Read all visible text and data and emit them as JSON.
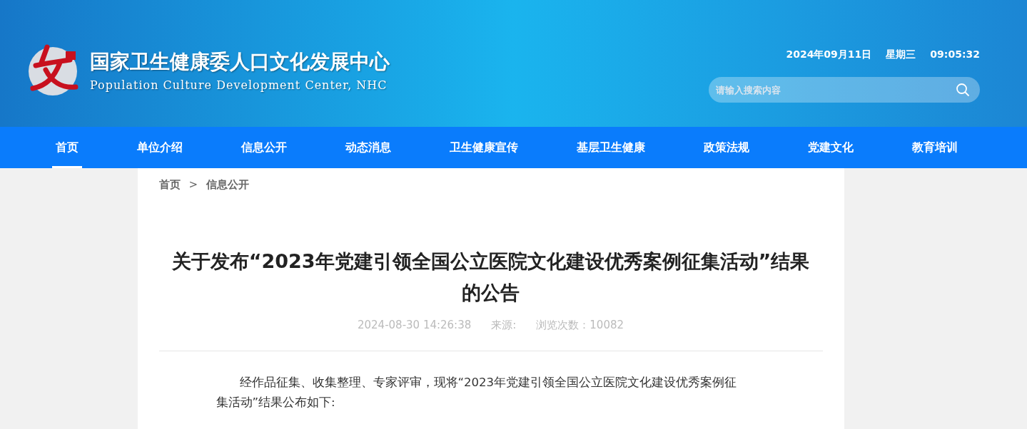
{
  "header": {
    "title": "国家卫生健康委人口文化发展中心",
    "subtitle": "Population Culture Development Center, NHC",
    "date": "2024年09月11日",
    "weekday": "星期三",
    "time": "09:05:32",
    "search": {
      "placeholder": "请输入搜索内容"
    }
  },
  "nav": [
    {
      "label": "首页",
      "selected": true
    },
    {
      "label": "单位介绍",
      "selected": false
    },
    {
      "label": "信息公开",
      "selected": false
    },
    {
      "label": "动态消息",
      "selected": false
    },
    {
      "label": "卫生健康宣传",
      "selected": false
    },
    {
      "label": "基层卫生健康",
      "selected": false
    },
    {
      "label": "政策法规",
      "selected": false
    },
    {
      "label": "党建文化",
      "selected": false
    },
    {
      "label": "教育培训",
      "selected": false
    }
  ],
  "breadcrumb": {
    "items": [
      "首页",
      "信息公开"
    ],
    "separator": ">"
  },
  "article": {
    "title": "关于发布“2023年党建引领全国公立医院文化建设优秀案例征集活动”结果的公告",
    "date": "2024-08-30 14:26:38",
    "source": "来源:",
    "views": "浏览次数：10082",
    "paragraph": "经作品征集、收集整理、专家评审，现将“2023年党建引领全国公立医院文化建设优秀案例征集活动”结果公布如下:"
  }
}
